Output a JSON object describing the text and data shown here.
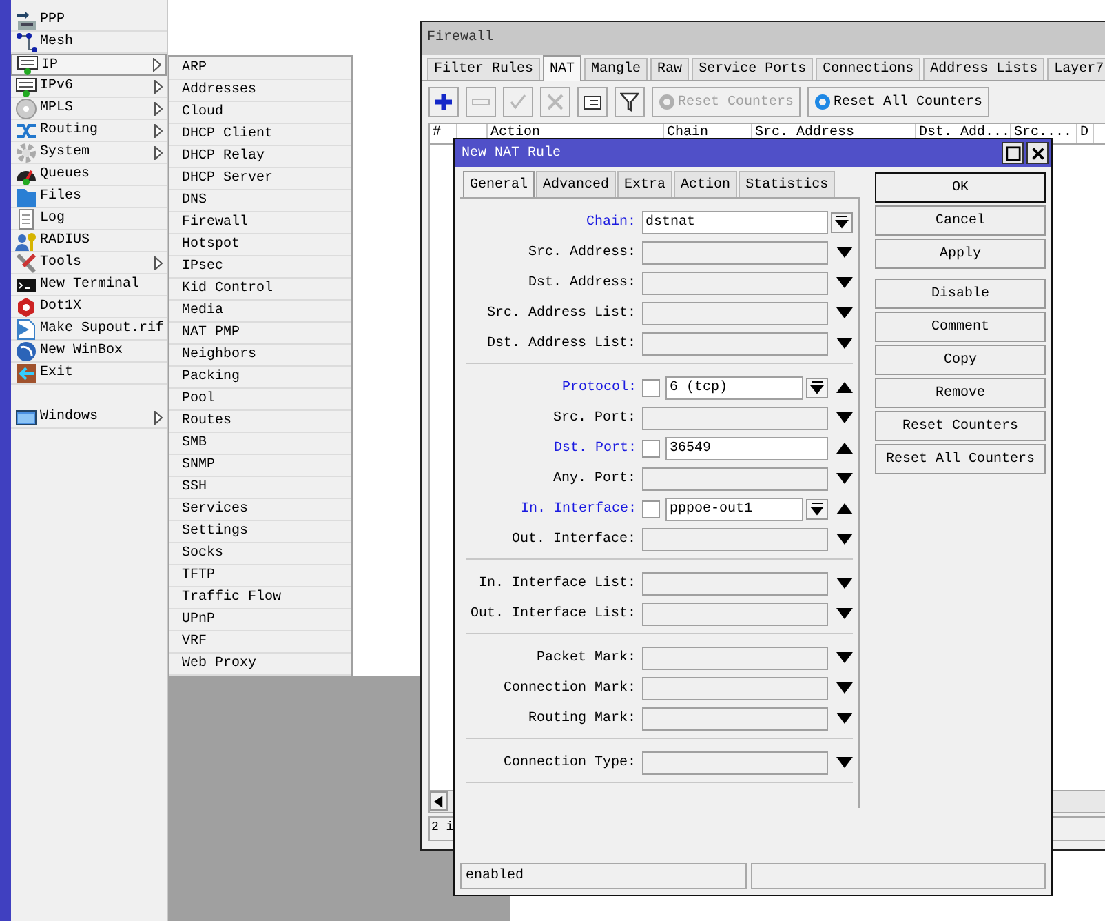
{
  "main_menu": [
    [
      {
        "label": "PPP",
        "submenu": false,
        "selected": false
      },
      {
        "label": "Mesh",
        "submenu": false,
        "selected": false
      },
      {
        "label": "IP",
        "submenu": true,
        "selected": true
      },
      {
        "label": "IPv6",
        "submenu": true,
        "selected": false
      },
      {
        "label": "MPLS",
        "submenu": true,
        "selected": false
      },
      {
        "label": "Routing",
        "submenu": true,
        "selected": false
      },
      {
        "label": "System",
        "submenu": true,
        "selected": false
      },
      {
        "label": "Queues",
        "submenu": false,
        "selected": false
      },
      {
        "label": "Files",
        "submenu": false,
        "selected": false
      },
      {
        "label": "Log",
        "submenu": false,
        "selected": false
      },
      {
        "label": "RADIUS",
        "submenu": false,
        "selected": false
      },
      {
        "label": "Tools",
        "submenu": true,
        "selected": false
      },
      {
        "label": "New Terminal",
        "submenu": false,
        "selected": false
      },
      {
        "label": "Dot1X",
        "submenu": false,
        "selected": false
      },
      {
        "label": "Make Supout.rif",
        "submenu": false,
        "selected": false
      },
      {
        "label": "New WinBox",
        "submenu": false,
        "selected": false
      },
      {
        "label": "Exit",
        "submenu": false,
        "selected": false
      }
    ],
    [
      {
        "label": "Windows",
        "submenu": true,
        "selected": false
      }
    ]
  ],
  "ip_submenu": [
    "ARP",
    "Addresses",
    "Cloud",
    "DHCP Client",
    "DHCP Relay",
    "DHCP Server",
    "DNS",
    "Firewall",
    "Hotspot",
    "IPsec",
    "Kid Control",
    "Media",
    "NAT PMP",
    "Neighbors",
    "Packing",
    "Pool",
    "Routes",
    "SMB",
    "SNMP",
    "SSH",
    "Services",
    "Settings",
    "Socks",
    "TFTP",
    "Traffic Flow",
    "UPnP",
    "VRF",
    "Web Proxy"
  ],
  "firewall": {
    "title": "Firewall",
    "tabs": [
      {
        "label": "Filter Rules",
        "selected": false
      },
      {
        "label": "NAT",
        "selected": true
      },
      {
        "label": "Mangle",
        "selected": false
      },
      {
        "label": "Raw",
        "selected": false
      },
      {
        "label": "Service Ports",
        "selected": false
      },
      {
        "label": "Connections",
        "selected": false
      },
      {
        "label": "Address Lists",
        "selected": false
      },
      {
        "label": "Layer7",
        "selected": false
      }
    ],
    "tools": [
      {
        "kind": "add",
        "disabled": false
      },
      {
        "kind": "remove",
        "disabled": true
      },
      {
        "kind": "enable",
        "disabled": true
      },
      {
        "kind": "disable",
        "disabled": true
      },
      {
        "kind": "comment",
        "disabled": false
      },
      {
        "kind": "filter",
        "disabled": false
      }
    ],
    "counter_buttons": [
      {
        "label": "Reset Counters",
        "disabled": true
      },
      {
        "label": "Reset All Counters",
        "disabled": false
      }
    ],
    "columns": [
      "#",
      "Action",
      "Chain",
      "Src. Address",
      "Dst. Add...",
      "Src....",
      "D"
    ],
    "status": "2 i"
  },
  "dialog": {
    "title": "New NAT Rule",
    "tabs": [
      {
        "label": "General",
        "selected": true
      },
      {
        "label": "Advanced",
        "selected": false
      },
      {
        "label": "Extra",
        "selected": false
      },
      {
        "label": "Action",
        "selected": false
      },
      {
        "label": "Statistics",
        "selected": false
      }
    ],
    "groups": [
      [
        {
          "label": "Chain:",
          "kind": "select",
          "value": "dstnat",
          "set": true
        },
        {
          "label": "Src. Address:",
          "kind": "text",
          "set": false
        },
        {
          "label": "Dst. Address:",
          "kind": "text",
          "set": false
        },
        {
          "label": "Src. Address List:",
          "kind": "text",
          "set": false
        },
        {
          "label": "Dst. Address List:",
          "kind": "text",
          "set": false
        }
      ],
      [
        {
          "label": "Protocol:",
          "kind": "select_negatable",
          "value": "6 (tcp)",
          "set": true,
          "negated": false
        },
        {
          "label": "Src. Port:",
          "kind": "text",
          "set": false
        },
        {
          "label": "Dst. Port:",
          "kind": "text_negatable",
          "value": "36549",
          "set": true,
          "negated": false
        },
        {
          "label": "Any. Port:",
          "kind": "text",
          "set": false
        },
        {
          "label": "In. Interface:",
          "kind": "select_negatable",
          "value": "pppoe-out1",
          "set": true,
          "negated": false
        },
        {
          "label": "Out. Interface:",
          "kind": "text",
          "set": false
        }
      ],
      [
        {
          "label": "In. Interface List:",
          "kind": "text",
          "set": false
        },
        {
          "label": "Out. Interface List:",
          "kind": "text",
          "set": false
        }
      ],
      [
        {
          "label": "Packet Mark:",
          "kind": "text",
          "set": false
        },
        {
          "label": "Connection Mark:",
          "kind": "text",
          "set": false
        },
        {
          "label": "Routing Mark:",
          "kind": "text",
          "set": false
        }
      ],
      [
        {
          "label": "Connection Type:",
          "kind": "text",
          "set": false
        }
      ]
    ],
    "buttons": [
      [
        {
          "label": "OK",
          "default": true
        },
        {
          "label": "Cancel",
          "default": false
        },
        {
          "label": "Apply",
          "default": false
        }
      ],
      [
        {
          "label": "Disable",
          "default": false
        },
        {
          "label": "Comment",
          "default": false
        },
        {
          "label": "Copy",
          "default": false
        },
        {
          "label": "Remove",
          "default": false
        },
        {
          "label": "Reset Counters",
          "default": false
        },
        {
          "label": "Reset All Counters",
          "default": false
        }
      ]
    ],
    "status": [
      "enabled"
    ]
  }
}
